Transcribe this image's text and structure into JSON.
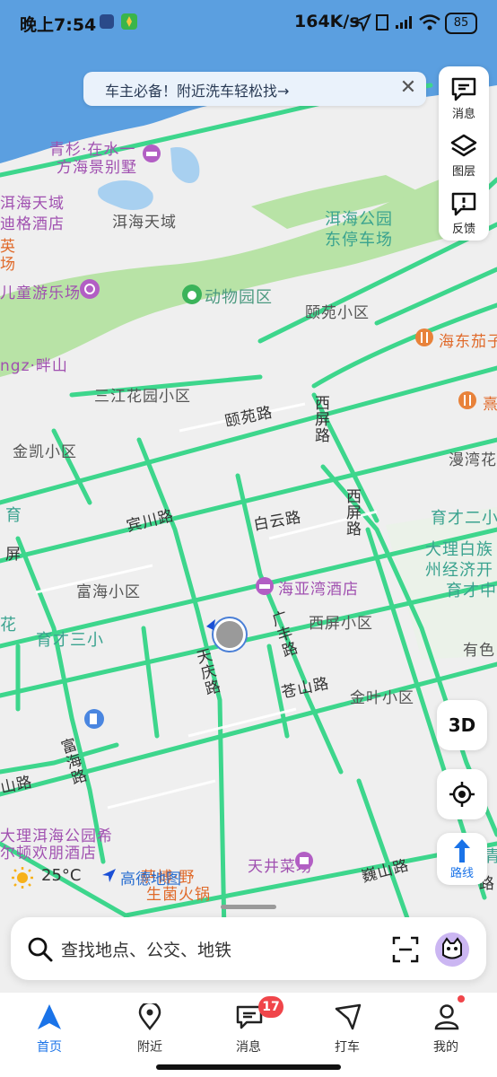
{
  "status_bar": {
    "time": "晚上7:54",
    "net_speed": "164K/s",
    "battery": "85"
  },
  "banner": {
    "text": "车主必备！附近洗车轻松找→"
  },
  "right_tools": [
    {
      "label": "消息",
      "icon": "message-icon"
    },
    {
      "label": "图层",
      "icon": "layers-icon"
    },
    {
      "label": "反馈",
      "icon": "feedback-icon"
    }
  ],
  "map": {
    "places": {
      "qingshan": "青杉·在水一",
      "qingshan2": "方海景别墅",
      "erhai_tianyu_l": "洱海天域",
      "didge": "迪格酒店",
      "erhai_tianyu": "洱海天域",
      "erhai_park": "洱海公园",
      "dongting": "东停车场",
      "ying": "英",
      "chang": "场",
      "kids": "儿童游乐场",
      "zoo": "动物园区",
      "yiyuan": "颐苑小区",
      "haidong": "海东茄子",
      "ngz": "ngz·畔山",
      "sanjiang": "三江花园小区",
      "yiyuan_rd": "颐苑路",
      "xiping_rd1": "西屏路",
      "xi": "熹",
      "jinkai": "金凯小区",
      "manwan": "漫湾花",
      "binchuan_rd": "宾川路",
      "baiyun_rd": "白云路",
      "xiping_rd2": "西屏路",
      "yucai2": "育才二小",
      "dali_bai": "大理白族",
      "zhou_econ": "州经济开",
      "yucai_mid": "育才中",
      "yu": "育",
      "fu": "屏",
      "fuhai": "富海小区",
      "haiyawan": "海亚湾酒店",
      "guangfeng": "广丰路",
      "xiping_xq": "西屏小区",
      "yuse": "有色",
      "hua": "花",
      "yucai3": "育才三小",
      "tianqing": "天庆路",
      "cangshan": "苍山路",
      "jinye": "金叶小区",
      "shan_rd": "山路",
      "fuhai_rd": "富海路",
      "dali_erhai_park": "大理洱海公园希",
      "hilton": "尔顿欢朋酒店",
      "tianjing": "天井菜场",
      "weishan": "巍山路",
      "huo": "生菌火锅",
      "pu": "萨博·野",
      "qing": "青",
      "lu": "路"
    }
  },
  "buttons": {
    "three_d": "3D",
    "route": "路线"
  },
  "weather": {
    "temp": "25°C",
    "icon": "sun-icon"
  },
  "amap_logo": "高德地图",
  "search": {
    "placeholder": "查找地点、公交、地铁"
  },
  "bottom_nav": [
    {
      "label": "首页",
      "icon": "navigate-arrow-icon",
      "active": true
    },
    {
      "label": "附近",
      "icon": "location-pin-icon"
    },
    {
      "label": "消息",
      "icon": "message-icon"
    },
    {
      "label": "打车",
      "icon": "taxi-icon"
    },
    {
      "label": "我的",
      "icon": "user-icon"
    }
  ],
  "message_badge": "17",
  "colors": {
    "road": "#3dd68c",
    "water": "#5b9fe0",
    "park": "#b8e3a6",
    "accent": "#1a73e8"
  }
}
